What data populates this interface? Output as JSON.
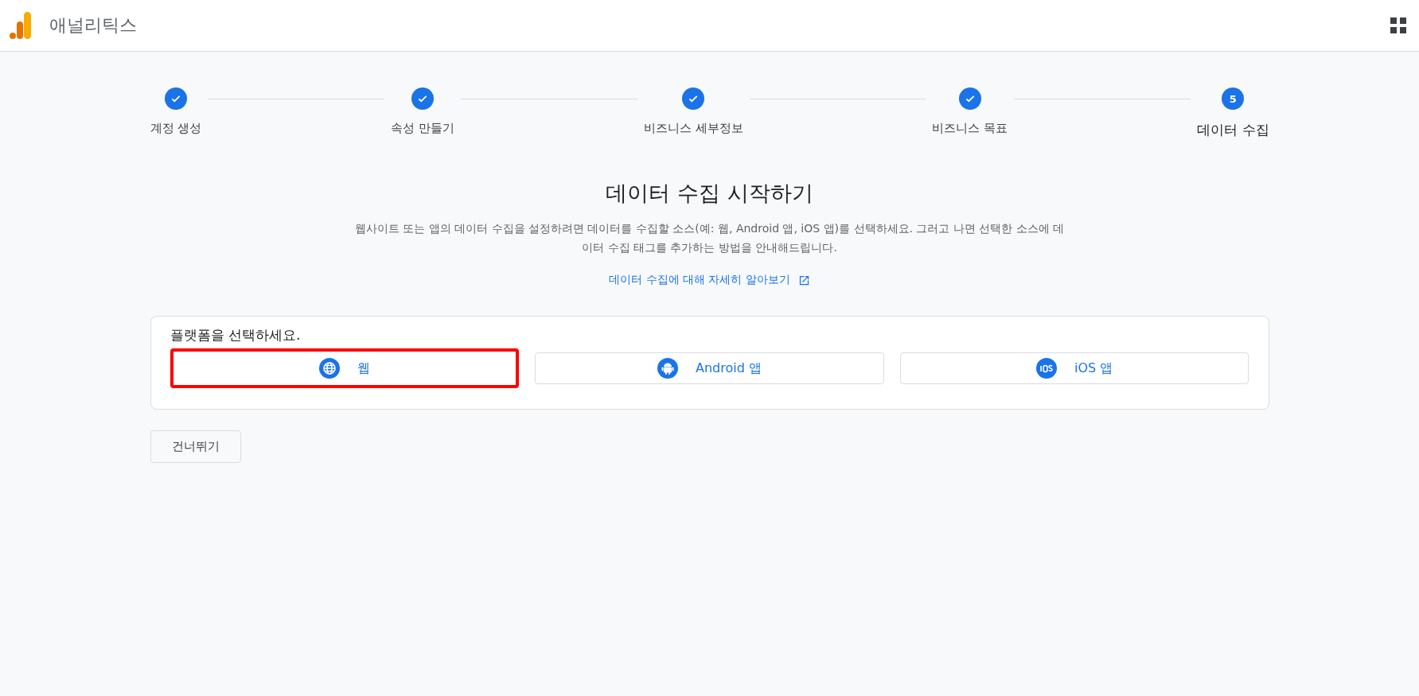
{
  "header": {
    "title": "애널리틱스"
  },
  "steps": [
    {
      "label": "계정 생성",
      "completed": true,
      "selected": false
    },
    {
      "label": "속성 만들기",
      "completed": true,
      "selected": false
    },
    {
      "label": "비즈니스 세부정보",
      "completed": true,
      "selected": false
    },
    {
      "label": "비즈니스 목표",
      "completed": true,
      "selected": false
    },
    {
      "label": "데이터 수집",
      "completed": false,
      "selected": true,
      "number": "5"
    }
  ],
  "heading": "데이터 수집 시작하기",
  "description": "웹사이트 또는 앱의 데이터 수집을 설정하려면 데이터를 수집할 소스(예: 웹, Android 앱, iOS 앱)를 선택하세요. 그러고 나면 선택한 소스에 데이터 수집 태그를 추가하는 방법을 안내해드립니다.",
  "learn_more_link": "데이터 수집에 대해 자세히 알아보기",
  "platform_card": {
    "prompt": "플랫폼을 선택하세요.",
    "platforms": [
      {
        "kind": "web",
        "label": "웹",
        "highlighted": true
      },
      {
        "kind": "android",
        "label": "Android 앱",
        "highlighted": false
      },
      {
        "kind": "ios",
        "label": "iOS 앱",
        "highlighted": false
      }
    ]
  },
  "skip_button": "건너뛰기"
}
